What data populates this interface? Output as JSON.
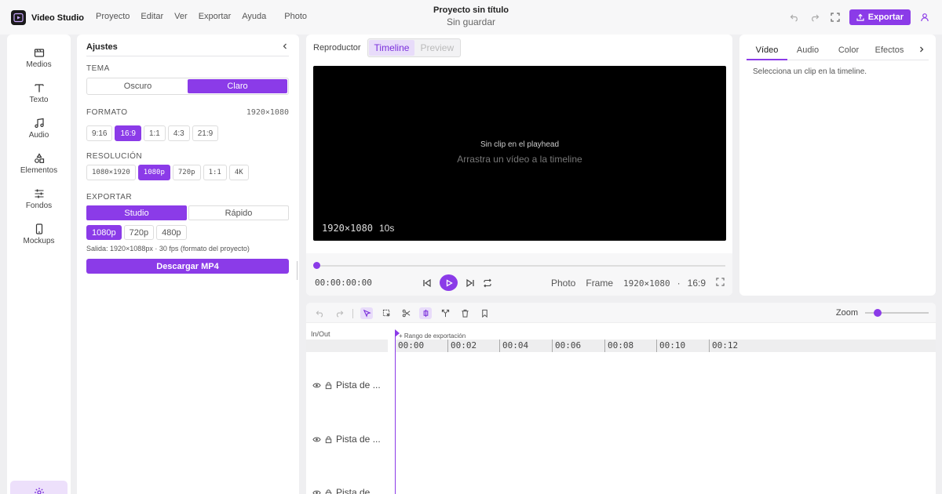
{
  "app": {
    "name": "Video Studio"
  },
  "menu": [
    "Proyecto",
    "Editar",
    "Ver",
    "Exportar",
    "Ayuda",
    "Photo"
  ],
  "project": {
    "title": "Proyecto sin título",
    "status": "Sin guardar"
  },
  "actions": {
    "export_label": "Exportar"
  },
  "sidebar": {
    "items": [
      {
        "label": "Medios",
        "icon": "media-icon"
      },
      {
        "label": "Texto",
        "icon": "text-icon"
      },
      {
        "label": "Audio",
        "icon": "music-icon"
      },
      {
        "label": "Elementos",
        "icon": "shapes-icon"
      },
      {
        "label": "Fondos",
        "icon": "sliders-icon"
      },
      {
        "label": "Mockups",
        "icon": "phone-icon"
      }
    ],
    "settings_icon": "gear-icon"
  },
  "settings": {
    "title": "Ajustes",
    "theme": {
      "label": "TEMA",
      "options": [
        "Oscuro",
        "Claro"
      ],
      "selected": "Claro"
    },
    "format": {
      "label": "FORMATO",
      "value": "1920×1080",
      "options": [
        "9:16",
        "16:9",
        "1:1",
        "4:3",
        "21:9"
      ],
      "selected": "16:9"
    },
    "resolution": {
      "label": "RESOLUCIÓN",
      "options": [
        "1080×1920",
        "1080p",
        "720p",
        "1:1",
        "4K"
      ],
      "selected": "1080p"
    },
    "export": {
      "label": "EXPORTAR",
      "modes": [
        "Studio",
        "Rápido"
      ],
      "mode_selected": "Studio",
      "qualities": [
        "1080p",
        "720p",
        "480p"
      ],
      "quality_selected": "1080p",
      "output_info": "Salida: 1920×1088px · 30 fps (formato del proyecto)",
      "download_label": "Descargar MP4"
    }
  },
  "player": {
    "tab_label": "Reproductor",
    "view_tabs": [
      "Timeline",
      "Preview"
    ],
    "view_selected": "Timeline",
    "message_primary": "Sin clip en el playhead",
    "message_secondary": "Arrastra un vídeo a la timeline",
    "overlay_resolution": "1920×1080",
    "overlay_duration": "10s",
    "timecode": "00:00:00:00",
    "progress": 0,
    "right_controls": {
      "photo": "Photo",
      "frame": "Frame",
      "resolution": "1920×1080",
      "separator": "·",
      "aspect": "16:9"
    }
  },
  "inspector": {
    "tabs": [
      "Vídeo",
      "Audio",
      "Color",
      "Efectos"
    ],
    "selected": "Vídeo",
    "message": "Selecciona un clip en la timeline."
  },
  "timeline": {
    "zoom_label": "Zoom",
    "zoom_level": 0.2,
    "inout_label": "In/Out",
    "range_label": "+ Rango de exportación",
    "ticks": [
      "00:00",
      "00:02",
      "00:04",
      "00:06",
      "00:08",
      "00:10",
      "00:12"
    ],
    "tracks": [
      "Pista de ...",
      "Pista de ...",
      "Pista de ..."
    ]
  },
  "colors": {
    "accent": "#8b3be8",
    "accent_light": "#e8dcfa",
    "background": "#efeff1",
    "screen": "#000000"
  }
}
